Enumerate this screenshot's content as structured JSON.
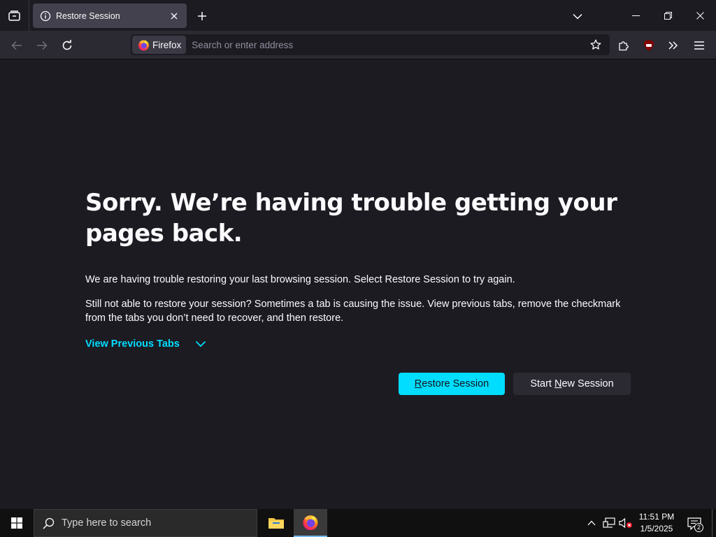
{
  "browser": {
    "tab": {
      "title": "Restore Session"
    },
    "urlbar": {
      "identity_label": "Firefox",
      "placeholder": "Search or enter address"
    }
  },
  "content": {
    "title": "Sorry. We’re having trouble getting your pages back.",
    "paragraph1": "We are having trouble restoring your last browsing session. Select Restore Session to try again.",
    "paragraph2": "Still not able to restore your session? Sometimes a tab is causing the issue. View previous tabs, remove the checkmark from the tabs you don’t need to recover, and then restore.",
    "view_previous_tabs": "View Previous Tabs",
    "restore_button": {
      "pre": "",
      "accel": "R",
      "post": "estore Session"
    },
    "new_session_button": {
      "pre": "Start ",
      "accel": "N",
      "post": "ew Session"
    }
  },
  "taskbar": {
    "search_placeholder": "Type here to search",
    "clock_time": "11:51 PM",
    "clock_date": "1/5/2025",
    "notification_count": "2"
  },
  "icons": {
    "tab_overview": "tab-overview-icon",
    "tab": "info-icon",
    "close": "close-icon",
    "new_tab": "plus-icon",
    "ublock": "ublock-origin-icon",
    "browser_logo": "firefox-logo-icon"
  },
  "colors": {
    "accent": "#00ddff",
    "page_bg": "#1c1b22",
    "toolbar_bg": "#2b2a33",
    "tab_bg": "#42414d",
    "ublock_red": "#800000"
  }
}
